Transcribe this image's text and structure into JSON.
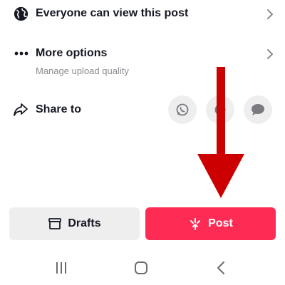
{
  "visibility": {
    "label": "Everyone can view this post",
    "icon": "globe-icon"
  },
  "more_options": {
    "label": "More options",
    "sublabel": "Manage upload quality",
    "icon": "more-dots-icon"
  },
  "share": {
    "label": "Share to",
    "icon": "share-arrow-icon",
    "targets": [
      "whatsapp-icon",
      "app-icon",
      "message-icon"
    ]
  },
  "actions": {
    "drafts_label": "Drafts",
    "post_label": "Post"
  },
  "annotation": {
    "color": "#cc0000",
    "icon": "down-arrow-annotation"
  },
  "colors": {
    "accent": "#fe2c55",
    "text": "#161823",
    "muted": "#8a8b91",
    "surface": "#eeeeef"
  },
  "system_nav": [
    "recent-apps-icon",
    "home-icon",
    "back-icon"
  ]
}
